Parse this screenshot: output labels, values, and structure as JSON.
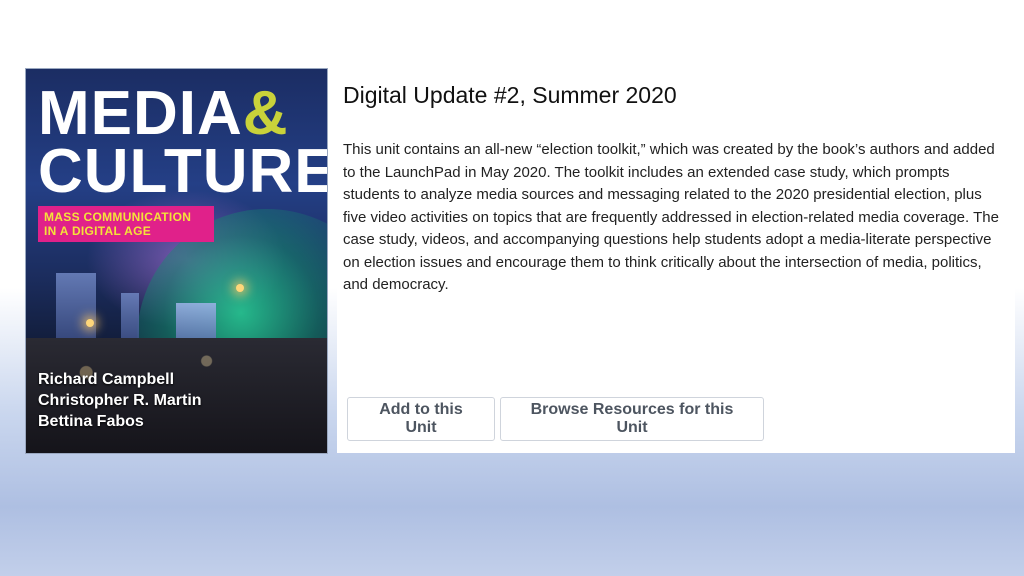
{
  "cover": {
    "title_media": "MEDIA",
    "title_amp": "&",
    "title_culture": "CULTURE",
    "subtitle_line1": "MASS COMMUNICATION",
    "subtitle_line2": "IN A DIGITAL AGE",
    "authors": [
      "Richard Campbell",
      "Christopher R. Martin",
      "Bettina Fabos"
    ]
  },
  "unit": {
    "title": "Digital Update #2, Summer 2020",
    "description": "This unit contains an all-new “election toolkit,” which was created by the book’s authors and added to the LaunchPad in May 2020. The toolkit includes an extended case study, which prompts students to analyze media sources and messaging related to the 2020 presidential election, plus five video activities on topics that are frequently addressed in election-related media coverage. The case study, videos, and accompanying questions help students adopt a media-literate perspective on election issues and encourage them to think critically about the intersection of media, politics, and democracy."
  },
  "actions": {
    "add_label": "Add to this Unit",
    "browse_label": "Browse Resources for this Unit"
  },
  "colors": {
    "cover_accent": "#c9d23a",
    "cover_tag_bg": "#e0218a",
    "cover_tag_text": "#f4e23a",
    "button_text": "#4d5560"
  }
}
